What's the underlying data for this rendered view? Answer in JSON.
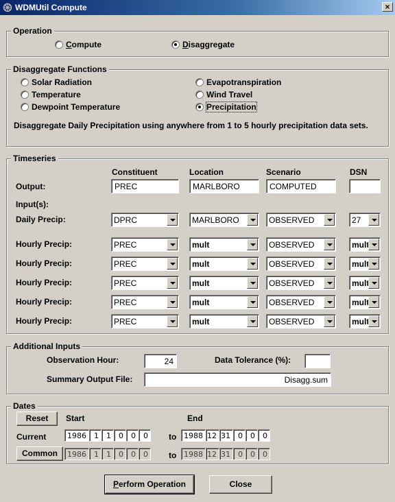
{
  "window": {
    "title": "WDMUtil Compute",
    "close_glyph": "×"
  },
  "operation": {
    "legend": "Operation",
    "options": [
      {
        "label": "Compute",
        "mnemonic": "C",
        "rest": "ompute",
        "selected": false
      },
      {
        "label": "Disaggregate",
        "mnemonic": "D",
        "rest": "isaggregate",
        "selected": true
      }
    ]
  },
  "functions": {
    "legend": "Disaggregate Functions",
    "options": [
      {
        "label": "Solar Radiation",
        "selected": false
      },
      {
        "label": "Temperature",
        "selected": false
      },
      {
        "label": "Dewpoint Temperature",
        "selected": false
      },
      {
        "label": "Evapotranspiration",
        "selected": false
      },
      {
        "label": "Wind Travel",
        "selected": false
      },
      {
        "label": "Precipitation",
        "selected": true
      }
    ],
    "description": "Disaggregate Daily Precipitation using anywhere from 1 to 5 hourly precipitation data sets."
  },
  "timeseries": {
    "legend": "Timeseries",
    "headers": {
      "constituent": "Constituent",
      "location": "Location",
      "scenario": "Scenario",
      "dsn": "DSN"
    },
    "output": {
      "label": "Output:",
      "constituent": "PREC",
      "location": "MARLBORO",
      "scenario": "COMPUTED",
      "dsn": ""
    },
    "inputs_label": "Input(s):",
    "rows": [
      {
        "label": "Daily Precip:",
        "constituent": "DPRC",
        "location": "MARLBORO",
        "scenario": "OBSERVED",
        "dsn": "27"
      },
      {
        "label": "Hourly Precip:",
        "constituent": "PREC",
        "location": "mult",
        "scenario": "OBSERVED",
        "dsn": "mult"
      },
      {
        "label": "Hourly Precip:",
        "constituent": "PREC",
        "location": "mult",
        "scenario": "OBSERVED",
        "dsn": "mult"
      },
      {
        "label": "Hourly Precip:",
        "constituent": "PREC",
        "location": "mult",
        "scenario": "OBSERVED",
        "dsn": "mult"
      },
      {
        "label": "Hourly Precip:",
        "constituent": "PREC",
        "location": "mult",
        "scenario": "OBSERVED",
        "dsn": "mult"
      },
      {
        "label": "Hourly Precip:",
        "constituent": "PREC",
        "location": "mult",
        "scenario": "OBSERVED",
        "dsn": "mult"
      }
    ]
  },
  "additional": {
    "legend": "Additional Inputs",
    "observation_hour_label": "Observation Hour:",
    "observation_hour": "24",
    "tolerance_label": "Data Tolerance (%):",
    "tolerance": "",
    "summary_label": "Summary Output File:",
    "summary_file": "Disagg.sum"
  },
  "dates": {
    "legend": "Dates",
    "reset_label": "Reset",
    "start_label": "Start",
    "end_label": "End",
    "to_label": "to",
    "current": {
      "label": "Current",
      "start": [
        "1986",
        "1",
        "1",
        "0",
        "0",
        "0"
      ],
      "end": [
        "1988",
        "12",
        "31",
        "0",
        "0",
        "0"
      ]
    },
    "common": {
      "label": "Common",
      "start": [
        "1986",
        "1",
        "1",
        "0",
        "0",
        "0"
      ],
      "end": [
        "1988",
        "12",
        "31",
        "0",
        "0",
        "0"
      ]
    }
  },
  "footer": {
    "perform_label": "Perform Operation",
    "perform_mnemonic": "P",
    "perform_rest": "erform Operation",
    "close_label": "Close"
  }
}
